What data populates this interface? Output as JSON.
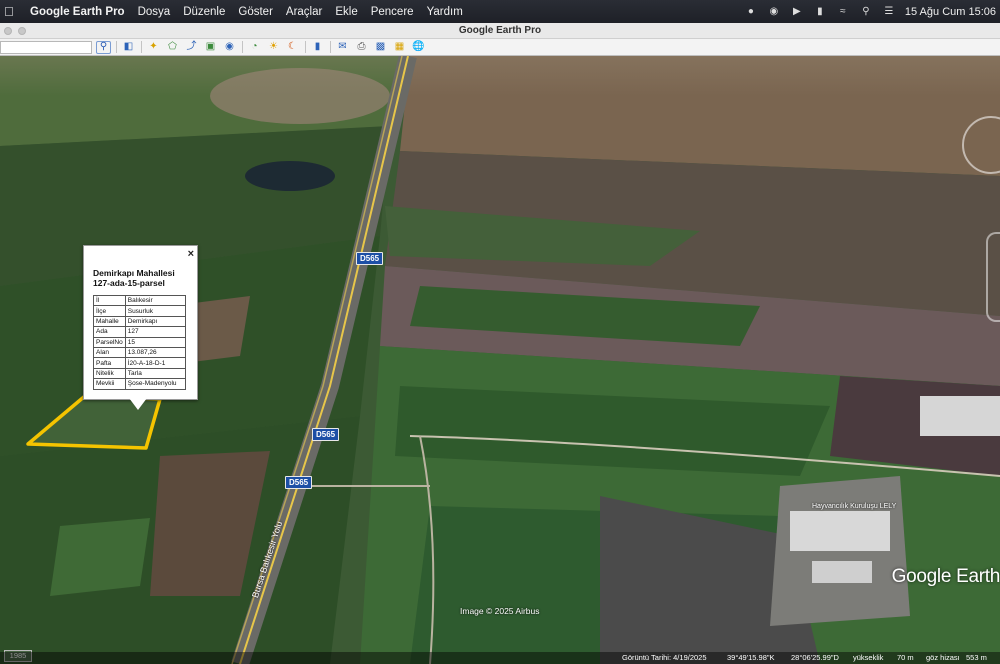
{
  "menubar": {
    "app_name": "Google Earth Pro",
    "menus": [
      "Dosya",
      "Düzenle",
      "Göster",
      "Araçlar",
      "Ekle",
      "Pencere",
      "Yardım"
    ],
    "clock": "15 Ağu Cum  15:06"
  },
  "window": {
    "title": "Google Earth Pro"
  },
  "map": {
    "road_labels": [
      "D565",
      "D565",
      "D565"
    ],
    "facility_label": "Hayvancılık Kuruluşu LELY",
    "imagery_credit": "Image © 2025 Airbus",
    "logo": "Google Earth"
  },
  "balloon": {
    "title_line1": "Demirkapı Mahallesi",
    "title_line2": "127-ada-15-parsel",
    "close": "×",
    "rows": [
      {
        "key": "İl",
        "value": "Balıkesir"
      },
      {
        "key": "İlçe",
        "value": "Susurluk"
      },
      {
        "key": "Mahalle",
        "value": "Demirkapı"
      },
      {
        "key": "Ada",
        "value": "127"
      },
      {
        "key": "ParselNo",
        "value": "15"
      },
      {
        "key": "Alan",
        "value": "13.087,26"
      },
      {
        "key": "Pafta",
        "value": "İ20-A-18-D-1"
      },
      {
        "key": "Nitelik",
        "value": "Tarla"
      },
      {
        "key": "Mevkii",
        "value": "Şose-Madenyolu"
      }
    ]
  },
  "road_name": "Bursa Balıkesir Yolu",
  "status": {
    "year": "1985",
    "imagery_date": "Görüntü Tarihi: 4/19/2025",
    "lat": "39°49'15.98\"K",
    "lon": "28°06'25.99\"D",
    "elevation_label": "yükseklik",
    "elevation": "70 m",
    "eye_alt_label": "göz hizası",
    "eye_alt": "553 m"
  },
  "colors": {
    "parcel_outline": "#f5c400",
    "road_shield": "#1d4fa6"
  }
}
